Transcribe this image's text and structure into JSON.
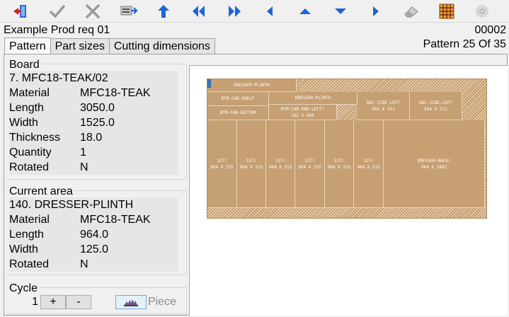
{
  "toolbar": {
    "icons": [
      "exit-icon",
      "accept-icon",
      "cancel-icon",
      "machine-icon",
      "up-icon",
      "first-icon",
      "last-icon",
      "previous-icon",
      "up-triangle-icon",
      "down-triangle-icon",
      "next-icon",
      "eraser-icon",
      "grid-icon",
      "settings-icon"
    ]
  },
  "header": {
    "title": "Example Prod req 01",
    "code": "00002",
    "pattern_info": "Pattern 25 Of 35"
  },
  "tabs": [
    {
      "label": "Pattern"
    },
    {
      "label": "Part sizes"
    },
    {
      "label": "Cutting dimensions"
    }
  ],
  "board": {
    "title": "Board",
    "name": "7. MFC18-TEAK/02",
    "rows": [
      {
        "k": "Material",
        "v": "MFC18-TEAK"
      },
      {
        "k": "Length",
        "v": "3050.0"
      },
      {
        "k": "Width",
        "v": "1525.0"
      },
      {
        "k": "Thickness",
        "v": "18.0"
      },
      {
        "k": "Quantity",
        "v": "1"
      },
      {
        "k": "Rotated",
        "v": "N"
      }
    ]
  },
  "current_area": {
    "title": "Current area",
    "name": "140. DRESSER-PLINTH",
    "rows": [
      {
        "k": "Material",
        "v": "MFC18-TEAK"
      },
      {
        "k": "Length",
        "v": "964.0"
      },
      {
        "k": "Width",
        "v": "125.0"
      },
      {
        "k": "Rotated",
        "v": "N"
      }
    ]
  },
  "cycle": {
    "title": "Cycle",
    "value": "1",
    "plus": "+",
    "minus": "-",
    "piece": "Piece"
  },
  "pieces": [
    {
      "name": "DRESSER-PLINTH",
      "size": ""
    },
    {
      "name": "BTM-CAB-SHELF",
      "size": ""
    },
    {
      "name": "DRESSER-PLINTH",
      "size": ""
    },
    {
      "name": "BTM-CAB-END-LEFT!",
      "size": "162 X 600"
    },
    {
      "name": "BTM-CAB-BOTTOM",
      "size": ""
    },
    {
      "name": "DDC-SIDE-LEFT",
      "size": "564 X 311"
    },
    {
      "name": "DDC-SIDE-LEFT",
      "size": "564 X 311"
    },
    {
      "name": "127!",
      "size": "964 X 315"
    },
    {
      "name": "127!",
      "size": "964 X 315"
    },
    {
      "name": "127!",
      "size": "964 X 315"
    },
    {
      "name": "127!",
      "size": "964 X 315"
    },
    {
      "name": "127!",
      "size": "964 X 315"
    },
    {
      "name": "127!",
      "size": "964 X 315"
    },
    {
      "name": "DRESSER-BACK!",
      "size": "964 X 1882"
    }
  ]
}
